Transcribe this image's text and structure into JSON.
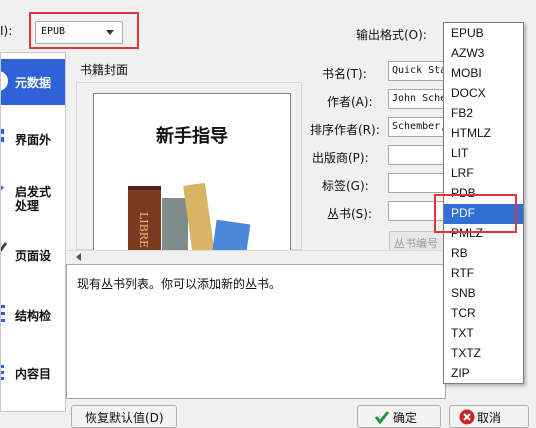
{
  "input_format": {
    "label": "I):",
    "value": "EPUB"
  },
  "output_format": {
    "label": "输出格式(O):",
    "options": [
      "EPUB",
      "AZW3",
      "MOBI",
      "DOCX",
      "FB2",
      "HTMLZ",
      "LIT",
      "LRF",
      "PDB",
      "PDF",
      "PMLZ",
      "RB",
      "RTF",
      "SNB",
      "TCR",
      "TXT",
      "TXTZ",
      "ZIP"
    ],
    "selected": "PDF"
  },
  "sidebar": {
    "items": [
      {
        "label": "元数据",
        "icon": "metadata-icon",
        "selected": true
      },
      {
        "label": "界面外",
        "icon": "look-feel-icon"
      },
      {
        "label": "启发式",
        "label2": "处理",
        "icon": "heuristic-icon"
      },
      {
        "label": "页面设",
        "icon": "page-setup-icon"
      },
      {
        "label": "结构检",
        "icon": "structure-icon"
      },
      {
        "label": "内容目",
        "icon": "toc-icon"
      }
    ]
  },
  "cover": {
    "group_title": "书籍封面",
    "heading": "新手指导",
    "spine_text": "LIBRE"
  },
  "fields": {
    "title": {
      "label": "书名(T):",
      "value": "Quick Start"
    },
    "author": {
      "label": "作者(A):",
      "value": "John Schember"
    },
    "author_sort": {
      "label": "排序作者(R):",
      "value": "Schember, John"
    },
    "publisher": {
      "label": "出版商(P):",
      "value": ""
    },
    "tags": {
      "label": "标签(G):",
      "value": ""
    },
    "series": {
      "label": "丛书(S):",
      "value": ""
    },
    "series_number_button": "丛书编号"
  },
  "comments": {
    "text": "现有丛书列表。你可以添加新的丛书。"
  },
  "buttons": {
    "restore": "恢复默认值(D)",
    "ok": "确定",
    "cancel": "取消"
  },
  "colors": {
    "selection": "#2f6fd6",
    "highlight_box": "#e0353b",
    "ok_green": "#1f9b35",
    "cancel_red": "#c9242a"
  }
}
